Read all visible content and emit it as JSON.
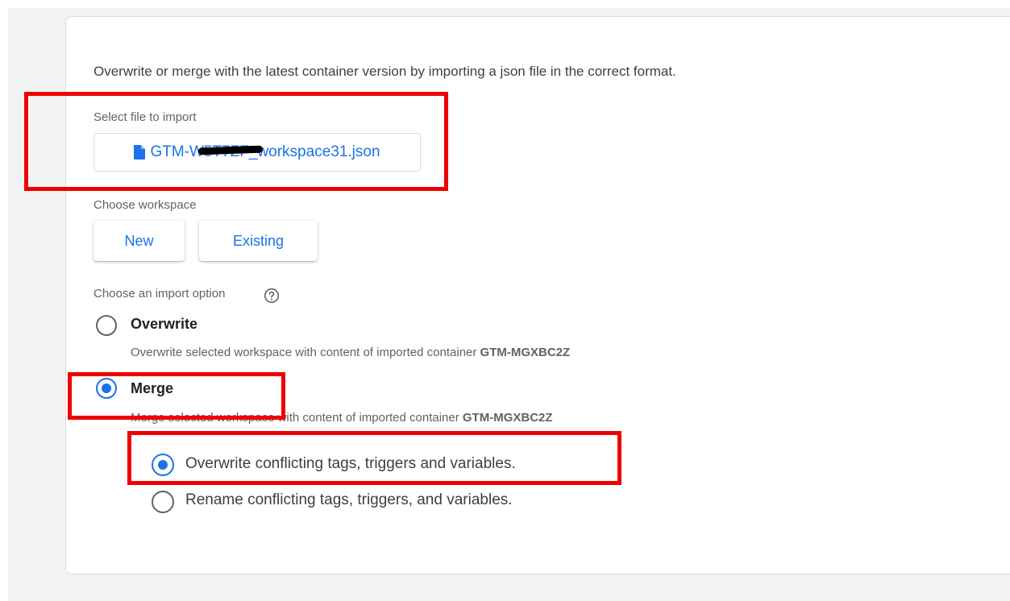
{
  "description": "Overwrite or merge with the latest container version by importing a json file in the correct format.",
  "file_section": {
    "label": "Select file to import",
    "file_name": "GTM-W5T7ZF_workspace31.json",
    "file_icon": "file-icon"
  },
  "workspace_section": {
    "label": "Choose workspace",
    "buttons": [
      "New",
      "Existing"
    ]
  },
  "import_section": {
    "label": "Choose an import option",
    "help_icon": "help-circle-icon",
    "options": [
      {
        "title": "Overwrite",
        "desc_prefix": "Overwrite selected workspace with content of imported container ",
        "container": "GTM-MGXBC2Z",
        "selected": false
      },
      {
        "title": "Merge",
        "desc_prefix": "Merge selected workspace with content of imported container ",
        "container": "GTM-MGXBC2Z",
        "selected": true
      }
    ],
    "merge_options": [
      {
        "label": "Overwrite conflicting tags, triggers and variables.",
        "selected": true
      },
      {
        "label": "Rename conflicting tags, triggers, and variables.",
        "selected": false
      }
    ]
  },
  "colors": {
    "accent": "#1a73e8",
    "annotation": "#ee0000"
  }
}
